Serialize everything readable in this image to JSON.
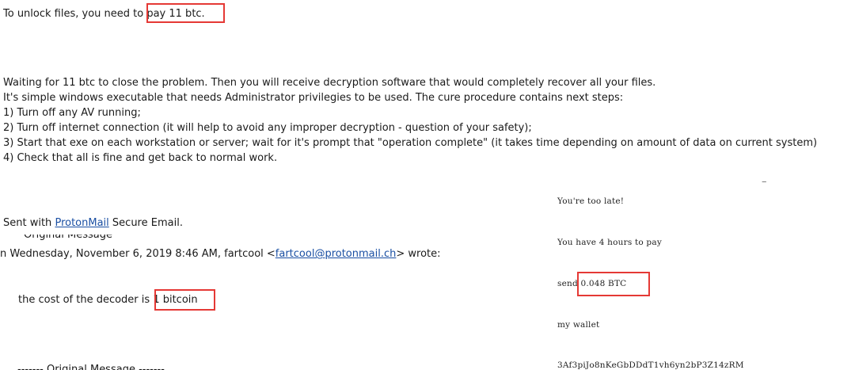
{
  "email": {
    "unlock_prefix": "To unlock files, you need to",
    "unlock_amount": "pay 11 btc.",
    "body_lines": [
      "Waiting for 11 btc to close the problem. Then you will receive decryption software that would completely recover all your files.",
      "It's simple windows executable that needs Administrator privilegies to be used. The cure procedure contains next steps:",
      "1) Turn off any AV running;",
      "2) Turn off internet connection (it will help to avoid any improper decryption - question of your safety);",
      "3) Start that exe on each workstation or server; wait for it's prompt that \"operation complete\" (it takes time depending on amount of data on current system)",
      "4) Check that all is fine and get back to normal work."
    ],
    "sent_with_prefix": "Sent with",
    "sent_with_link": "ProtonMail",
    "sent_with_suffix": "Secure Email.",
    "original_message_top": "Original Message",
    "quote_header_prefix": "n Wednesday, November 6, 2019 8:46 AM, fartcool <",
    "quote_header_email": "fartcool@protonmail.ch",
    "quote_header_suffix": "> wrote:",
    "decoder_prefix": "the cost of the decoder is",
    "decoder_amount": "1 bitcoin",
    "original_message_bottom": "------- Original Message -------"
  },
  "note": {
    "line1": "You're too late!",
    "line2": "You have 4 hours to pay",
    "send_prefix": "send",
    "send_amount": "0.048 BTC",
    "wallet_label": "my wallet",
    "wallet_address": "3Af3piJo8nKeGbDDdT1vh6yn2bP3Z14zRM",
    "dash": "–"
  },
  "colors": {
    "highlight_box": "#e53935",
    "link": "#1a4fa3"
  }
}
